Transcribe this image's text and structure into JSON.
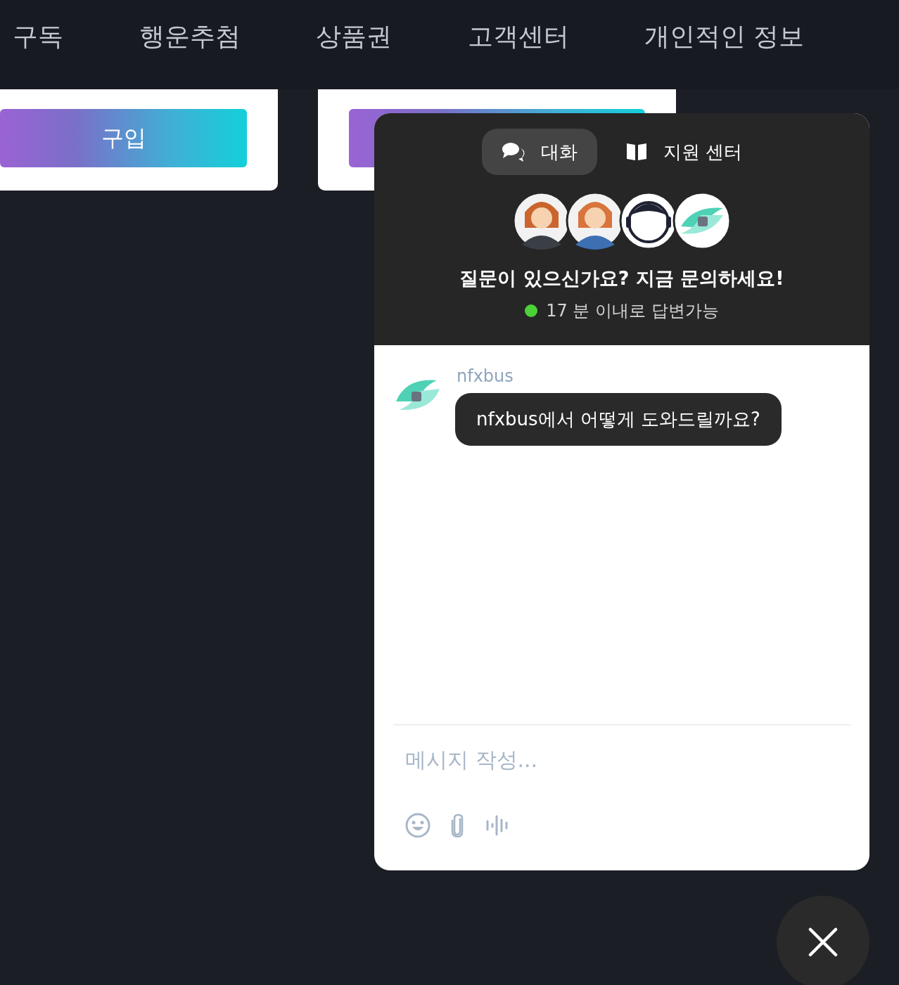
{
  "nav": {
    "items": [
      "구독",
      "행운추첨",
      "상품권",
      "고객센터",
      "개인적인 정보"
    ]
  },
  "cards": [
    {
      "kind": "labeled",
      "button": "구입"
    },
    {
      "kind": "covered"
    }
  ],
  "chat": {
    "tabs": [
      {
        "label": "대화",
        "kind": "chat",
        "selected": true
      },
      {
        "label": "지원 센터",
        "kind": "help",
        "selected": false
      }
    ],
    "avatars": [
      {
        "kind": "person"
      },
      {
        "kind": "person"
      },
      {
        "kind": "agent"
      },
      {
        "kind": "logo"
      }
    ],
    "headline": "질문이 있으신가요? 지금 문의하세요!",
    "status": {
      "text": "17 분 이내로 답변가능",
      "color": "#4cd137"
    },
    "messages": [
      {
        "sender": "nfxbus",
        "text": "nfxbus에서 어떻게 도와드릴까요?"
      }
    ],
    "composer": {
      "placeholder": "메시지 작성..."
    }
  }
}
